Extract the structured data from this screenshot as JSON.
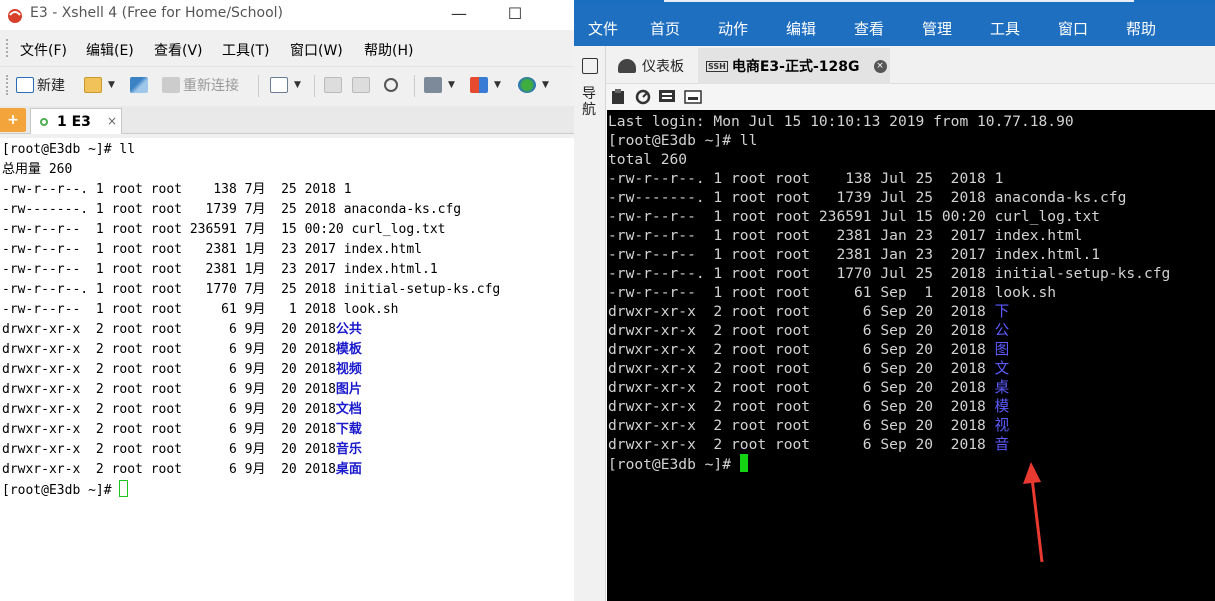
{
  "left_window": {
    "title": "E3 - Xshell 4 (Free for Home/School)",
    "menu": [
      "文件(F)",
      "编辑(E)",
      "查看(V)",
      "工具(T)",
      "窗口(W)",
      "帮助(H)"
    ],
    "toolbar": {
      "new_label": "新建",
      "reconnect_label": "重新连接"
    },
    "tab": {
      "label": "1 E3",
      "close": "×"
    },
    "terminal_lines": [
      "[root@E3db ~]# ll",
      "总用量 260",
      "-rw-r--r--. 1 root root    138 7月  25 2018 1",
      "-rw-------. 1 root root   1739 7月  25 2018 anaconda-ks.cfg",
      "-rw-r--r--  1 root root 236591 7月  15 00:20 curl_log.txt",
      "-rw-r--r--  1 root root   2381 1月  23 2017 index.html",
      "-rw-r--r--  1 root root   2381 1月  23 2017 index.html.1",
      "-rw-r--r--. 1 root root   1770 7月  25 2018 initial-setup-ks.cfg",
      "-rw-r--r--  1 root root     61 9月   1 2018 look.sh"
    ],
    "dir_lines": [
      {
        "prefix": "drwxr-xr-x  2 root root      6 9月  20 2018",
        "name": "公共"
      },
      {
        "prefix": "drwxr-xr-x  2 root root      6 9月  20 2018",
        "name": "模板"
      },
      {
        "prefix": "drwxr-xr-x  2 root root      6 9月  20 2018",
        "name": "视频"
      },
      {
        "prefix": "drwxr-xr-x  2 root root      6 9月  20 2018",
        "name": "图片"
      },
      {
        "prefix": "drwxr-xr-x  2 root root      6 9月  20 2018",
        "name": "文档"
      },
      {
        "prefix": "drwxr-xr-x  2 root root      6 9月  20 2018",
        "name": "下载"
      },
      {
        "prefix": "drwxr-xr-x  2 root root      6 9月  20 2018",
        "name": "音乐"
      },
      {
        "prefix": "drwxr-xr-x  2 root root      6 9月  20 2018",
        "name": "桌面"
      }
    ],
    "prompt": "[root@E3db ~]# "
  },
  "right_window": {
    "menu": [
      "文件",
      "首页",
      "动作",
      "编辑",
      "查看",
      "管理",
      "工具",
      "窗口",
      "帮助"
    ],
    "side_label": "导航",
    "tabs": {
      "dashboard": "仪表板",
      "session": "电商E3-正式-128G",
      "ssh_badge": "SSH",
      "close": "×"
    },
    "terminal_lines": [
      "Last login: Mon Jul 15 10:10:13 2019 from 10.77.18.90",
      "[root@E3db ~]# ll",
      "total 260",
      "-rw-r--r--. 1 root root    138 Jul 25  2018 1",
      "-rw-------. 1 root root   1739 Jul 25  2018 anaconda-ks.cfg",
      "-rw-r--r--  1 root root 236591 Jul 15 00:20 curl_log.txt",
      "-rw-r--r--  1 root root   2381 Jan 23  2017 index.html",
      "-rw-r--r--  1 root root   2381 Jan 23  2017 index.html.1",
      "-rw-r--r--. 1 root root   1770 Jul 25  2018 initial-setup-ks.cfg",
      "-rw-r--r--  1 root root     61 Sep  1  2018 look.sh"
    ],
    "dir_lines": [
      {
        "prefix": "drwxr-xr-x  2 root root      6 Sep 20  2018 ",
        "name": "下"
      },
      {
        "prefix": "drwxr-xr-x  2 root root      6 Sep 20  2018 ",
        "name": "公"
      },
      {
        "prefix": "drwxr-xr-x  2 root root      6 Sep 20  2018 ",
        "name": "图"
      },
      {
        "prefix": "drwxr-xr-x  2 root root      6 Sep 20  2018 ",
        "name": "文"
      },
      {
        "prefix": "drwxr-xr-x  2 root root      6 Sep 20  2018 ",
        "name": "桌"
      },
      {
        "prefix": "drwxr-xr-x  2 root root      6 Sep 20  2018 ",
        "name": "模"
      },
      {
        "prefix": "drwxr-xr-x  2 root root      6 Sep 20  2018 ",
        "name": "视"
      },
      {
        "prefix": "drwxr-xr-x  2 root root      6 Sep 20  2018 ",
        "name": "音"
      }
    ],
    "prompt": "[root@E3db ~]# "
  },
  "colors": {
    "xshell_dir": "#1a1acc",
    "right_dir": "#5b5bff",
    "right_menubar": "#1f6fc0",
    "cursor_green": "#13d313",
    "arrow_red": "#e83a30"
  }
}
